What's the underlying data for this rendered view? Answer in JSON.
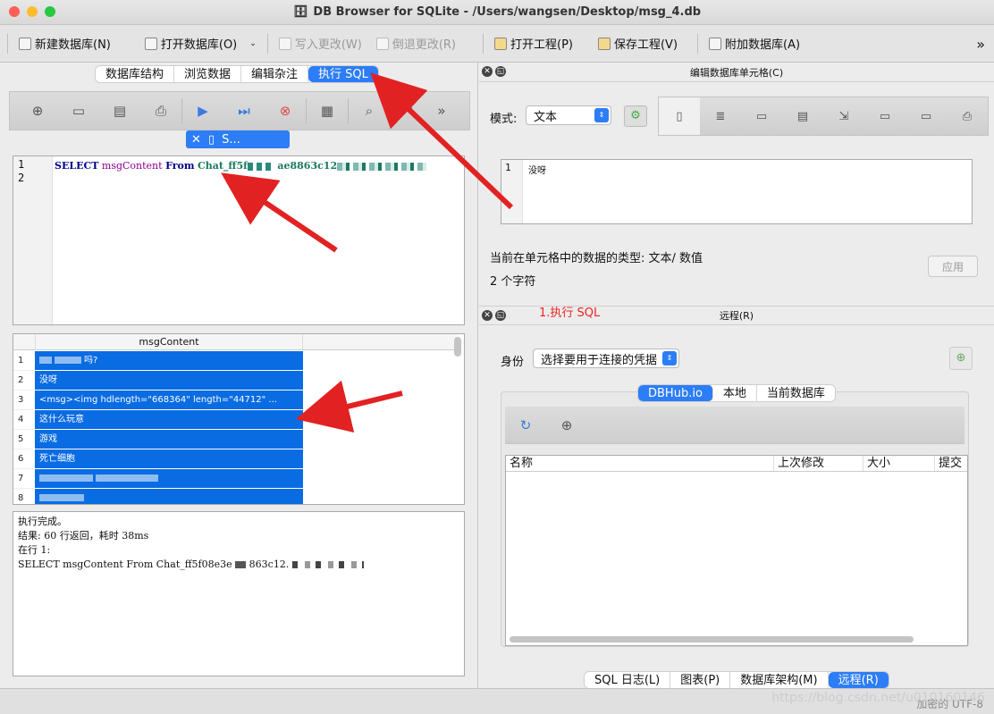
{
  "window": {
    "title": "DB Browser for SQLite - /Users/wangsen/Desktop/msg_4.db"
  },
  "toolbar": {
    "new_db": "新建数据库(N)",
    "open_db": "打开数据库(O)",
    "write_changes": "写入更改(W)",
    "revert_changes": "倒退更改(R)",
    "open_project": "打开工程(P)",
    "save_project": "保存工程(V)",
    "attach_db": "附加数据库(A)",
    "more": "»"
  },
  "main_tabs": {
    "items": [
      "数据库结构",
      "浏览数据",
      "编辑杂注",
      "执行 SQL"
    ],
    "active_index": 3
  },
  "sql_editor": {
    "tab_label": "S...",
    "line_numbers": [
      "1",
      "2"
    ],
    "keyword_select": "SELECT",
    "column": "msgContent",
    "keyword_from": "From",
    "table_prefix": "Chat_ff5f",
    "table_suffix": "ae8863c12"
  },
  "results": {
    "column_header": "msgContent",
    "rows": [
      {
        "num": "1",
        "text": "吗?"
      },
      {
        "num": "2",
        "text": "没呀"
      },
      {
        "num": "3",
        "text": "<msg><img hdlength=\"668364\" length=\"44712\" ..."
      },
      {
        "num": "4",
        "text": "这什么玩意"
      },
      {
        "num": "5",
        "text": "游戏"
      },
      {
        "num": "6",
        "text": "死亡细胞"
      },
      {
        "num": "7",
        "text": ""
      },
      {
        "num": "8",
        "text": ""
      }
    ]
  },
  "log": {
    "line1": "执行完成。",
    "line2": "结果: 60 行返回，耗时 38ms",
    "line3": "在行 1:",
    "line4_prefix": "SELECT msgContent From Chat_ff5f08e3e",
    "line4_mid": "863c12."
  },
  "edit_cell": {
    "dock_title": "编辑数据库单元格(C)",
    "mode_label": "模式:",
    "mode_value": "文本",
    "line_number": "1",
    "cell_value": "没呀",
    "annotation": "1.执行 SQL",
    "type_info": "当前在单元格中的数据的类型: 文本/ 数值",
    "char_count": "2 个字符",
    "apply_button": "应用"
  },
  "remote": {
    "dock_title": "远程(R)",
    "identity_label": "身份",
    "identity_placeholder": "选择要用于连接的凭据",
    "tabs": [
      "DBHub.io",
      "本地",
      "当前数据库"
    ],
    "active_index": 0,
    "columns": [
      "名称",
      "上次修改",
      "大小",
      "提交"
    ]
  },
  "bottom_tabs": {
    "items": [
      "SQL 日志(L)",
      "图表(P)",
      "数据库架构(M)",
      "远程(R)"
    ],
    "active_index": 3
  },
  "statusbar": {
    "encoding": "加密的  UTF-8",
    "watermark": "https://blog.csdn.net/u010160146"
  },
  "colors": {
    "accent": "#2c7df6",
    "selection": "#0a6ce3",
    "arrow": "#e22222"
  }
}
